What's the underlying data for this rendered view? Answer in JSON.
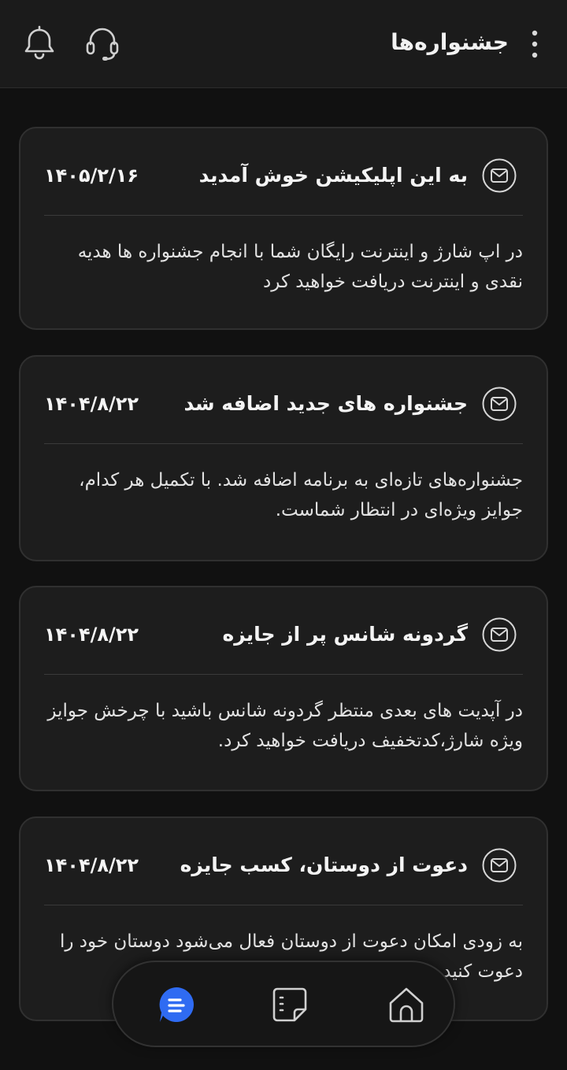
{
  "header": {
    "title": "جشنواره‌ها",
    "icons": [
      "menu-icon",
      "support-icon",
      "bell-icon"
    ]
  },
  "notifications": [
    {
      "title": "به این اپلیکیشن خوش آمدید",
      "date": "۱۴۰۵/۲/۱۶",
      "body": "در اپ شارژ و اینترنت رایگان شما با انجام جشنواره ها هدیه نقدی و اینترنت دریافت خواهید کرد"
    },
    {
      "title": "جشنواره های جدید اضافه شد",
      "date": "۱۴۰۴/۸/۲۲",
      "body": "جشنواره‌های تازه‌ای به برنامه اضافه شد. با تکمیل هر کدام، جوایز ویژه‌ای در انتظار شماست."
    },
    {
      "title": "گردونه شانس پر از جایزه",
      "date": "۱۴۰۴/۸/۲۲",
      "body": "در آپدیت های بعدی منتظر گردونه شانس باشید با چرخش جوایز ویژه شارژ،کدتخفیف دریافت خواهید کرد."
    },
    {
      "title": "دعوت از دوستان، کسب جایزه",
      "date": "۱۴۰۴/۸/۲۲",
      "body": "به زودی امکان دعوت از دوستان فعال می‌شود دوستان خود را دعوت کنید و جایزه بگیرید."
    }
  ],
  "bottom_nav": {
    "items": [
      "home-icon",
      "cards-icon",
      "festivals-icon"
    ],
    "active": "festivals-icon",
    "active_color": "#2f6bf2"
  }
}
